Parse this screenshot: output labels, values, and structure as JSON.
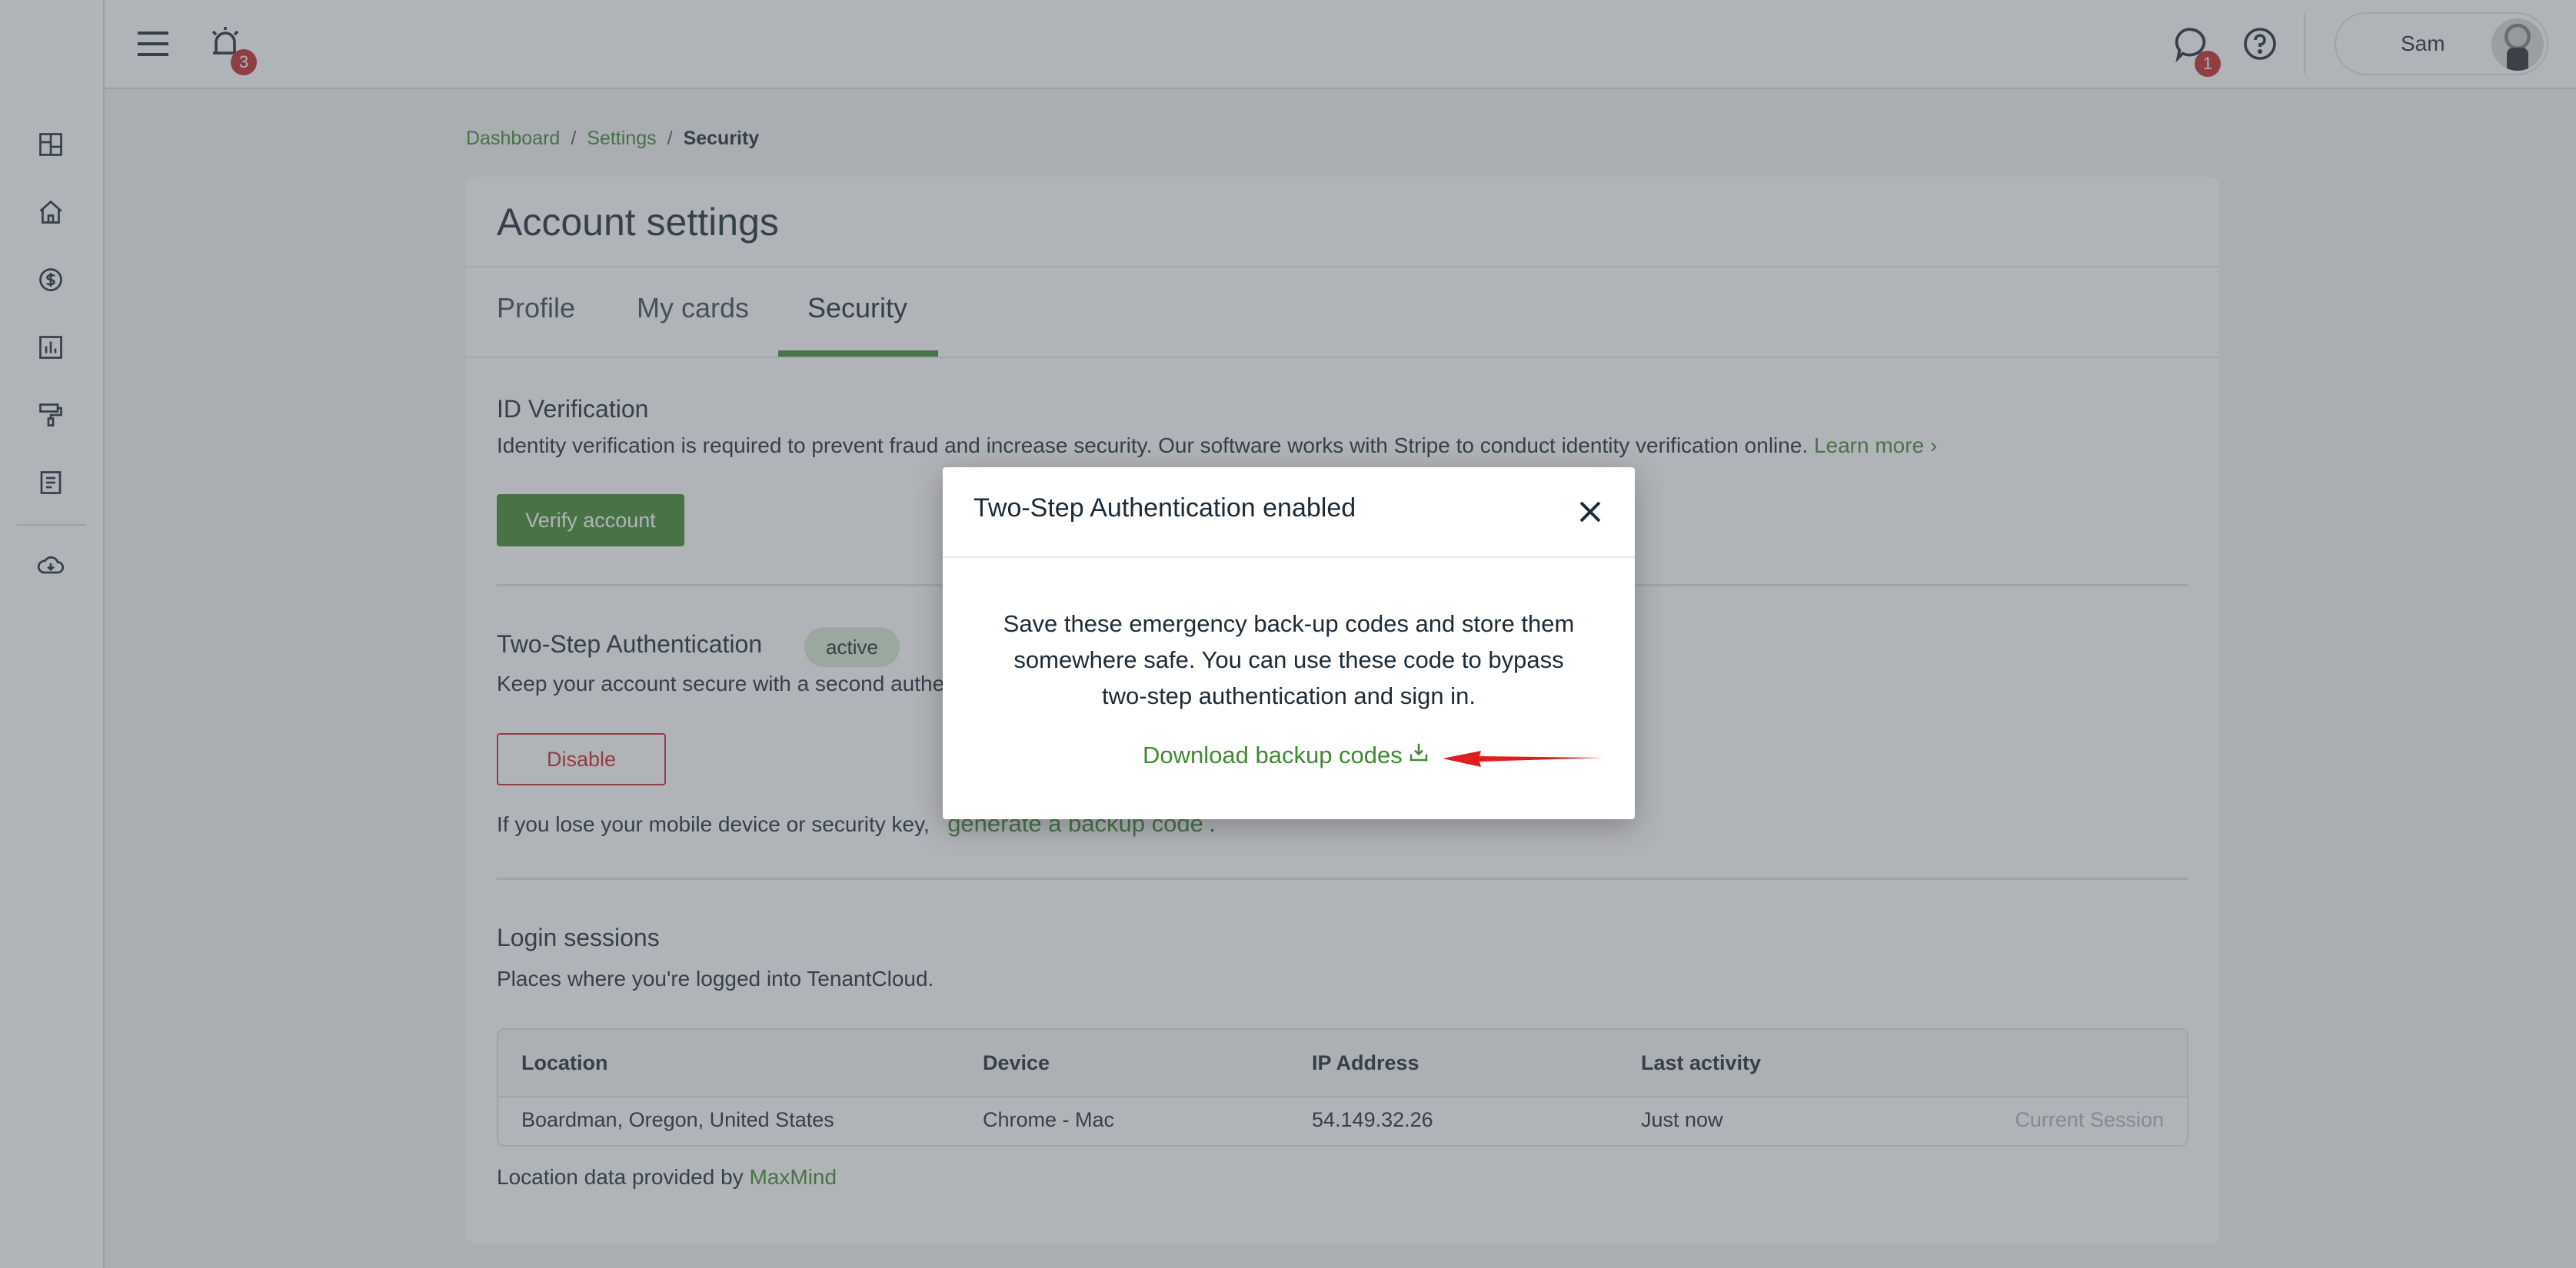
{
  "header": {
    "notification_count": "3",
    "messages_count": "1",
    "user_name": "Sam"
  },
  "breadcrumb": {
    "dashboard": "Dashboard",
    "settings": "Settings",
    "current": "Security"
  },
  "page": {
    "title": "Account settings",
    "tabs": [
      {
        "label": "Profile"
      },
      {
        "label": "My cards"
      },
      {
        "label": "Security"
      }
    ]
  },
  "id_verification": {
    "title": "ID Verification",
    "description": "Identity verification is required to prevent fraud and increase security. Our software works with Stripe to conduct identity verification online.",
    "learn_more": "Learn more",
    "button": "Verify account"
  },
  "two_step": {
    "title": "Two-Step Authentication",
    "status": "active",
    "description": "Keep your account secure with a second authen",
    "button": "Disable",
    "backup_text": "If you lose your mobile device or security key,",
    "backup_link": "generate a backup code",
    "backup_end": "."
  },
  "sessions": {
    "title": "Login sessions",
    "description": "Places where you're logged into TenantCloud.",
    "columns": [
      "Location",
      "Device",
      "IP Address",
      "Last activity"
    ],
    "rows": [
      {
        "location": "Boardman, Oregon, United States",
        "device": "Chrome - Mac",
        "ip": "54.149.32.26",
        "last_activity": "Just now",
        "note": "Current Session"
      }
    ],
    "footer_text": "Location data provided by",
    "footer_link": "MaxMind"
  },
  "modal": {
    "title": "Two-Step Authentication enabled",
    "body": "Save these emergency back-up codes and store them somewhere safe. You can use these code to bypass two-step authentication and sign in.",
    "download_label": "Download backup codes"
  },
  "colors": {
    "accent": "#3f8a30",
    "danger": "#c3272b",
    "overlay": "rgba(82, 90, 98, 0.46)"
  }
}
